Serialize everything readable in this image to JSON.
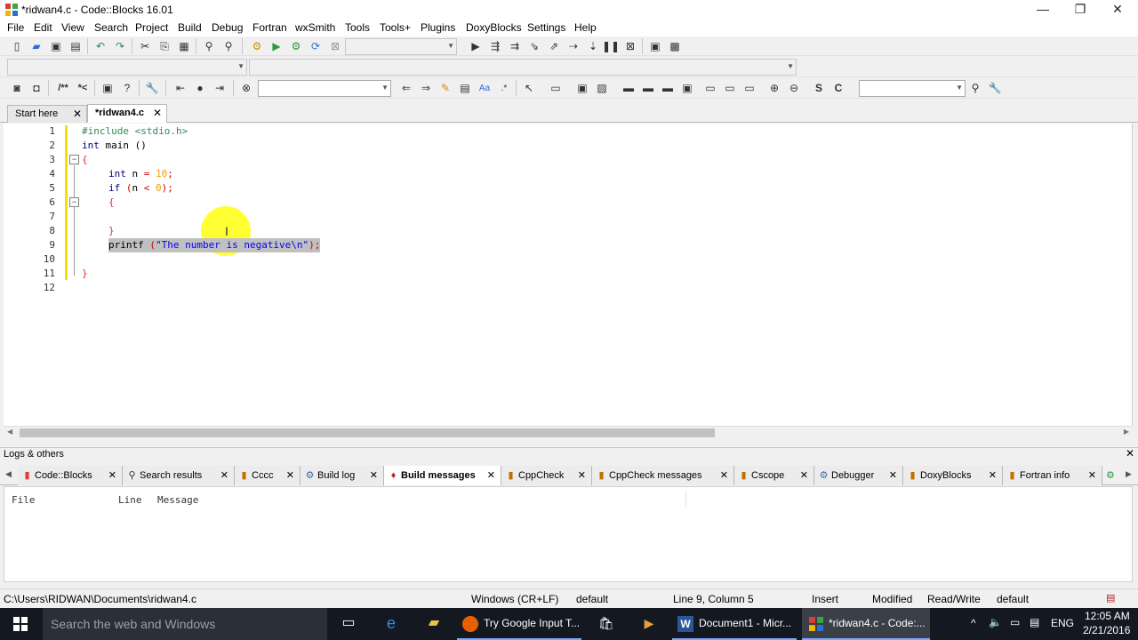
{
  "window": {
    "title": "*ridwan4.c - Code::Blocks 16.01",
    "controls": [
      "—",
      "❐",
      "✕"
    ]
  },
  "menu": [
    "File",
    "Edit",
    "View",
    "Search",
    "Project",
    "Build",
    "Debug",
    "Fortran",
    "wxSmith",
    "Tools",
    "Tools+",
    "Plugins",
    "DoxyBlocks",
    "Settings",
    "Help"
  ],
  "tabs": [
    {
      "label": "Start here",
      "active": false
    },
    {
      "label": "*ridwan4.c",
      "active": true
    }
  ],
  "editor": {
    "line_numbers": [
      "1",
      "2",
      "3",
      "4",
      "5",
      "6",
      "7",
      "8",
      "9",
      "10",
      "11",
      "12"
    ],
    "code": {
      "l1": "#include <stdio.h>",
      "l2_kw": "int",
      "l2_rest": " main ()",
      "l3": "{",
      "l4_kw": "int",
      "l4_rest": " n ",
      "l4_eq": "=",
      "l4_num": " 10",
      "l4_end": ";",
      "l5_kw": "if",
      "l5_open": " (",
      "l5_n": "n ",
      "l5_lt": "<",
      "l5_num": " 0",
      "l5_close": ");",
      "l6": "{",
      "l8": "}",
      "l9_fn": "printf ",
      "l9_paren": "(",
      "l9_str": "\"The number is negative\\n\"",
      "l9_end": ");",
      "l11": "}"
    }
  },
  "logs": {
    "title": "Logs & others",
    "tabs": [
      {
        "label": "Code::Blocks",
        "icon": "codeblocks-icon",
        "active": false
      },
      {
        "label": "Search results",
        "icon": "search-icon",
        "active": false
      },
      {
        "label": "Cccc",
        "icon": "cccc-icon",
        "active": false
      },
      {
        "label": "Build log",
        "icon": "gear-icon",
        "active": false
      },
      {
        "label": "Build messages",
        "icon": "build-messages-icon",
        "active": true
      },
      {
        "label": "CppCheck",
        "icon": "cppcheck-icon",
        "active": false
      },
      {
        "label": "CppCheck messages",
        "icon": "cppcheck-icon",
        "active": false
      },
      {
        "label": "Cscope",
        "icon": "cscope-icon",
        "active": false
      },
      {
        "label": "Debugger",
        "icon": "debugger-icon",
        "active": false
      },
      {
        "label": "DoxyBlocks",
        "icon": "doxyblocks-icon",
        "active": false
      },
      {
        "label": "Fortran info",
        "icon": "fortran-icon",
        "active": false
      }
    ],
    "columns": [
      "File",
      "Line",
      "Message"
    ]
  },
  "status": {
    "path": "C:\\Users\\RIDWAN\\Documents\\ridwan4.c",
    "eol": "Windows (CR+LF)",
    "encoding": "default",
    "position": "Line 9, Column 5",
    "mode": "Insert",
    "modified": "Modified",
    "access": "Read/Write",
    "profile": "default"
  },
  "taskbar": {
    "search_placeholder": "Search the web and Windows",
    "apps": [
      {
        "label": "Try Google Input T...",
        "icon": "firefox-icon"
      },
      {
        "label": "Document1 - Micr...",
        "icon": "word-icon"
      },
      {
        "label": "*ridwan4.c - Code:...",
        "icon": "codeblocks-icon"
      }
    ],
    "language": "ENG",
    "time": "12:05 AM",
    "date": "2/21/2016"
  },
  "colors": {
    "keyword": "#00008b",
    "preprocessor": "#2e8b57",
    "number": "#f0a000",
    "string": "#0000ff",
    "selection": "#c0c0c0",
    "change_bar": "#f5e000"
  }
}
